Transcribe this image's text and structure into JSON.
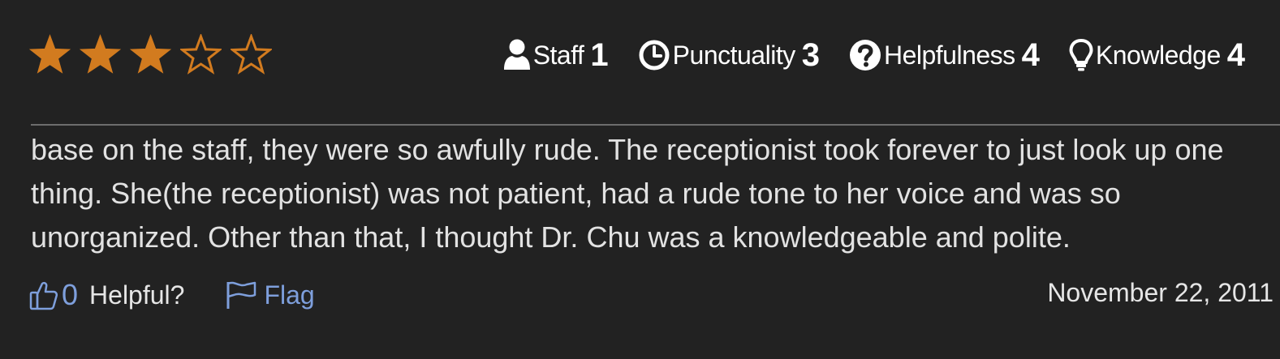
{
  "overall_rating": {
    "value": 3,
    "max": 5,
    "filled_color": "#d27b1f",
    "empty_color": "#d27b1f",
    "icon": "star-icon"
  },
  "category_ratings": [
    {
      "icon": "user-icon",
      "label": "Staff",
      "score": "1"
    },
    {
      "icon": "clock-icon",
      "label": "Punctuality",
      "score": "3"
    },
    {
      "icon": "question-circle-icon",
      "label": "Helpfulness",
      "score": "4"
    },
    {
      "icon": "lightbulb-icon",
      "label": "Knowledge",
      "score": "4"
    }
  ],
  "review": {
    "text": "base on the staff, they were so awfully rude. The receptionist took forever to just look up one thing. She(the receptionist) was not patient, had a rude tone to her voice and was so unorganized. Other than that, I thought Dr. Chu was a knowledgeable and polite."
  },
  "footer": {
    "helpful_count": "0",
    "helpful_label": "Helpful?",
    "flag_label": "Flag",
    "date": "November 22, 2011",
    "link_color": "#7e9fdc"
  }
}
